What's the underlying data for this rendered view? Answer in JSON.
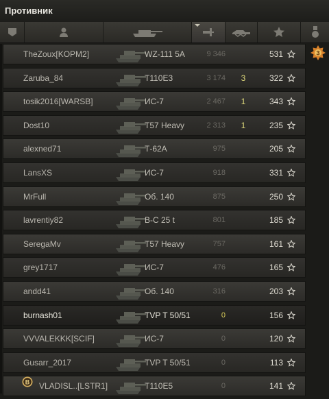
{
  "panel": {
    "title": "Противник"
  },
  "header": {
    "icons": [
      "platoon-icon",
      "player-icon",
      "tank-icon",
      "damage-icon",
      "frags-icon",
      "points-icon",
      "medals-icon"
    ]
  },
  "rows": [
    {
      "player": "TheZoux[KOPM2]",
      "vehicle": "WZ-111 5A",
      "damage": "9 346",
      "frags": "",
      "points": "531",
      "style": "normal"
    },
    {
      "player": "Zaruba_84",
      "vehicle": "T110E3",
      "damage": "3 174",
      "frags": "3",
      "points": "322",
      "style": "alt"
    },
    {
      "player": "tosik2016[WARSB]",
      "vehicle": "ИС-7",
      "damage": "2 467",
      "frags": "1",
      "points": "343",
      "style": "normal"
    },
    {
      "player": "Dost10",
      "vehicle": "T57 Heavy",
      "damage": "2 313",
      "frags": "1",
      "points": "235",
      "style": "alt"
    },
    {
      "player": "alexned71",
      "vehicle": "Т-62А",
      "damage": "975",
      "frags": "",
      "points": "205",
      "style": "normal"
    },
    {
      "player": "LansXS",
      "vehicle": "ИС-7",
      "damage": "918",
      "frags": "",
      "points": "331",
      "style": "alt"
    },
    {
      "player": "MrFull",
      "vehicle": "Об. 140",
      "damage": "875",
      "frags": "",
      "points": "250",
      "style": "normal"
    },
    {
      "player": "lavrentiy82",
      "vehicle": "B-C 25 t",
      "damage": "801",
      "frags": "",
      "points": "185",
      "style": "alt"
    },
    {
      "player": "SeregaMv",
      "vehicle": "T57 Heavy",
      "damage": "757",
      "frags": "",
      "points": "161",
      "style": "normal"
    },
    {
      "player": "grey1717",
      "vehicle": "ИС-7",
      "damage": "476",
      "frags": "",
      "points": "165",
      "style": "alt"
    },
    {
      "player": "andd41",
      "vehicle": "Об. 140",
      "damage": "316",
      "frags": "",
      "points": "203",
      "style": "normal"
    },
    {
      "player": "burnash01",
      "vehicle": "TVP T 50/51",
      "damage": "0",
      "frags": "",
      "points": "156",
      "style": "self"
    },
    {
      "player": "VVVALEKKK[SCIF]",
      "vehicle": "ИС-7",
      "damage": "0",
      "frags": "",
      "points": "120",
      "style": "normal"
    },
    {
      "player": "Gusarr_2017",
      "vehicle": "TVP T 50/51",
      "damage": "0",
      "frags": "",
      "points": "113",
      "style": "alt"
    },
    {
      "player": "VLADISL..[LSTR1]",
      "vehicle": "T110E5",
      "damage": "0",
      "frags": "",
      "points": "141",
      "style": "normal"
    }
  ],
  "medal": {
    "label": "3",
    "icon": "mastery-medal-icon"
  },
  "badge": {
    "label": "B",
    "icon": "rank-badge-icon"
  },
  "colors": {
    "accent": "#e2dc7d",
    "damage_self": "#dccf5a",
    "medal": "#d9822b"
  }
}
